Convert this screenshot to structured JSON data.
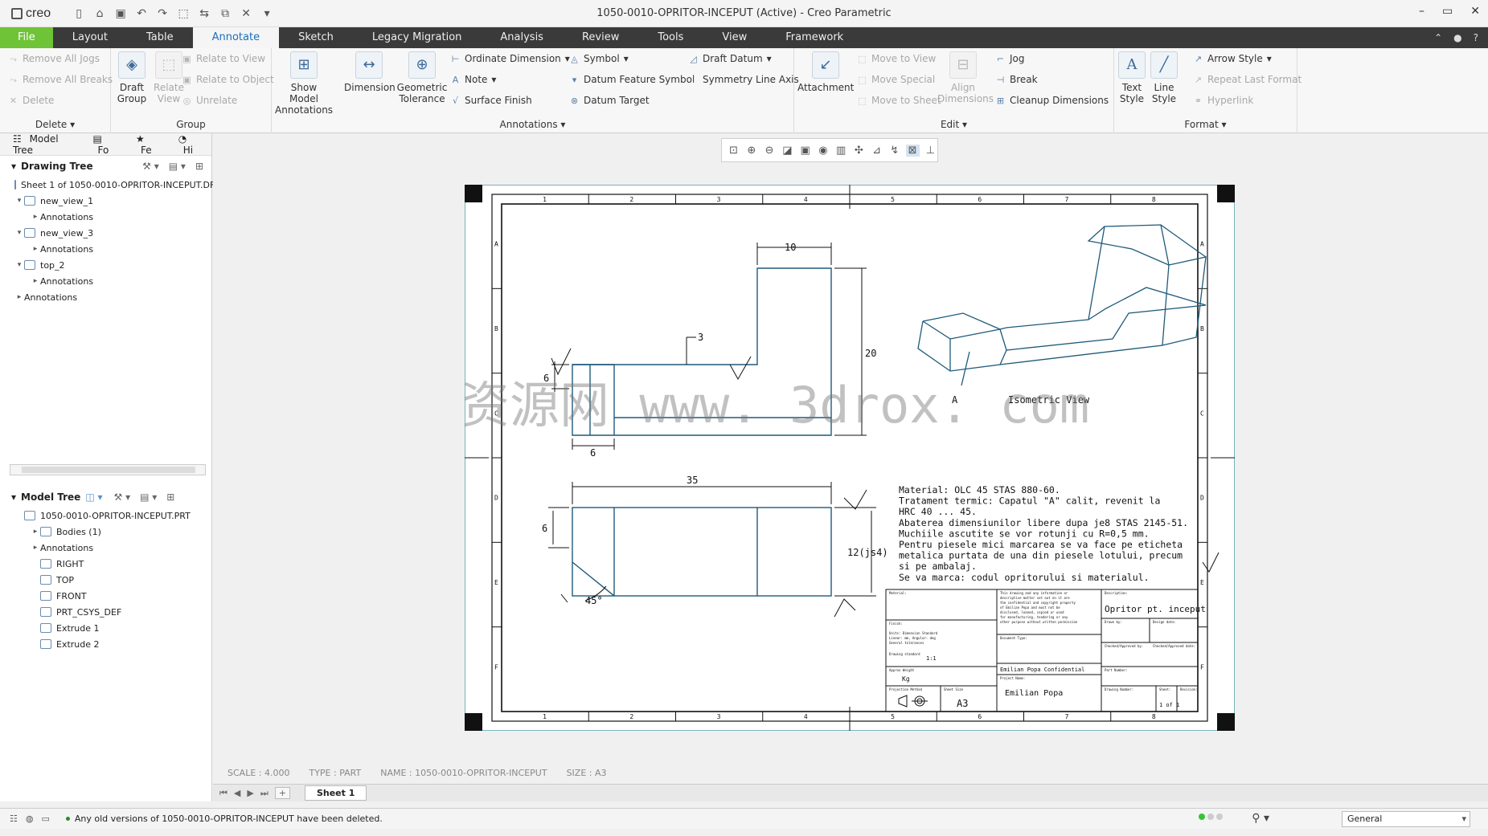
{
  "window": {
    "app_logo": "creo",
    "title": "1050-0010-OPRITOR-INCEPUT (Active) - Creo Parametric",
    "controls": [
      "–",
      "▭",
      "✕"
    ]
  },
  "menu": {
    "tabs": [
      "File",
      "Layout",
      "Table",
      "Annotate",
      "Sketch",
      "Legacy Migration",
      "Analysis",
      "Review",
      "Tools",
      "View",
      "Framework"
    ],
    "active": "Annotate"
  },
  "ribbon": {
    "delete_group": {
      "label": "Delete",
      "items": [
        "Remove All Jogs",
        "Remove All Breaks",
        "Delete"
      ]
    },
    "group_group": {
      "label": "Group",
      "draft_group": "Draft Group",
      "relate_view": "Relate View",
      "items": [
        "Relate to View",
        "Relate to Object",
        "Unrelate"
      ]
    },
    "annotations_group": {
      "label": "Annotations",
      "show_model": "Show Model Annotations",
      "dimension": "Dimension",
      "geom_tol": "Geometric Tolerance",
      "col1": [
        "Ordinate Dimension",
        "Note",
        "Surface Finish"
      ],
      "col2": [
        "Symbol",
        "Datum Feature Symbol",
        "Datum Target"
      ],
      "col3": [
        "Draft Datum",
        "Symmetry Line Axis"
      ]
    },
    "edit_group": {
      "label": "Edit",
      "attachment": "Attachment",
      "align": "Align Dimensions",
      "col1": [
        "Move to View",
        "Move Special",
        "Move to Sheet"
      ],
      "col2": [
        "Jog",
        "Break",
        "Cleanup Dimensions"
      ]
    },
    "format_group": {
      "label": "Format",
      "text_style": "Text Style",
      "line_style": "Line Style",
      "items": [
        "Arrow Style",
        "Repeat Last Format",
        "Hyperlink"
      ]
    }
  },
  "left_panel": {
    "tabs": [
      "Model Tree",
      "Fo",
      "Fe",
      "Hi"
    ],
    "drawing_tree": {
      "title": "Drawing Tree",
      "nodes": [
        {
          "label": "Sheet 1 of 1050-0010-OPRITOR-INCEPUT.DF",
          "level": 0
        },
        {
          "label": "new_view_1",
          "level": 0
        },
        {
          "label": "Annotations",
          "level": 1
        },
        {
          "label": "new_view_3",
          "level": 0
        },
        {
          "label": "Annotations",
          "level": 1
        },
        {
          "label": "top_2",
          "level": 0
        },
        {
          "label": "Annotations",
          "level": 1
        },
        {
          "label": "Annotations",
          "level": 0
        }
      ]
    },
    "model_tree": {
      "title": "Model Tree",
      "nodes": [
        {
          "label": "1050-0010-OPRITOR-INCEPUT.PRT",
          "level": 0
        },
        {
          "label": "Bodies (1)",
          "level": 1
        },
        {
          "label": "Annotations",
          "level": 1
        },
        {
          "label": "RIGHT",
          "level": 1
        },
        {
          "label": "TOP",
          "level": 1
        },
        {
          "label": "FRONT",
          "level": 1
        },
        {
          "label": "PRT_CSYS_DEF",
          "level": 1
        },
        {
          "label": "Extrude 1",
          "level": 1
        },
        {
          "label": "Extrude 2",
          "level": 1
        }
      ]
    }
  },
  "drawing": {
    "col_numbers": [
      "1",
      "2",
      "3",
      "4",
      "5",
      "6",
      "7",
      "8"
    ],
    "row_letters": [
      "A",
      "B",
      "C",
      "D",
      "E",
      "F"
    ],
    "dims": {
      "d10": "10",
      "d20": "20",
      "d3": "3",
      "d6a": "6",
      "d6b": "6",
      "d35": "35",
      "d6c": "6",
      "d12": "12(js4)",
      "d45": "45°"
    },
    "view_label_a": "A",
    "isometric_label": "Isometric View",
    "watermark": "资源网 www. 3drox. com",
    "notes": [
      "Material: OLC 45 STAS 880-60.",
      "Tratament termic: Capatul \"A\" calit, revenit la",
      "HRC 40 ... 45.",
      "Abaterea dimensiunilor libere dupa je8 STAS 2145-51.",
      "Muchiile ascutite se vor rotunji cu R=0,5 mm.",
      "Pentru piesele mici marcarea se va face pe eticheta",
      "metalica purtata de una din piesele lotului, precum",
      "si pe ambalaj.",
      "Se va marca: codul opritorului si materialul."
    ],
    "title_block": {
      "description": "Opritor pt. inceput",
      "confidential": "Emilian Popa Confidential",
      "author": "Emilian Popa",
      "size": "A3",
      "scale": "1:1",
      "weight": "Kg",
      "sheet": "1 of 1"
    }
  },
  "drawing_info": {
    "scale": "SCALE : 4.000",
    "type": "TYPE : PART",
    "name": "NAME : 1050-0010-OPRITOR-INCEPUT",
    "size": "SIZE : A3"
  },
  "sheetbar": {
    "tab": "Sheet 1"
  },
  "status": {
    "message": "Any old versions of 1050-0010-OPRITOR-INCEPUT have been deleted.",
    "filter": "General"
  }
}
